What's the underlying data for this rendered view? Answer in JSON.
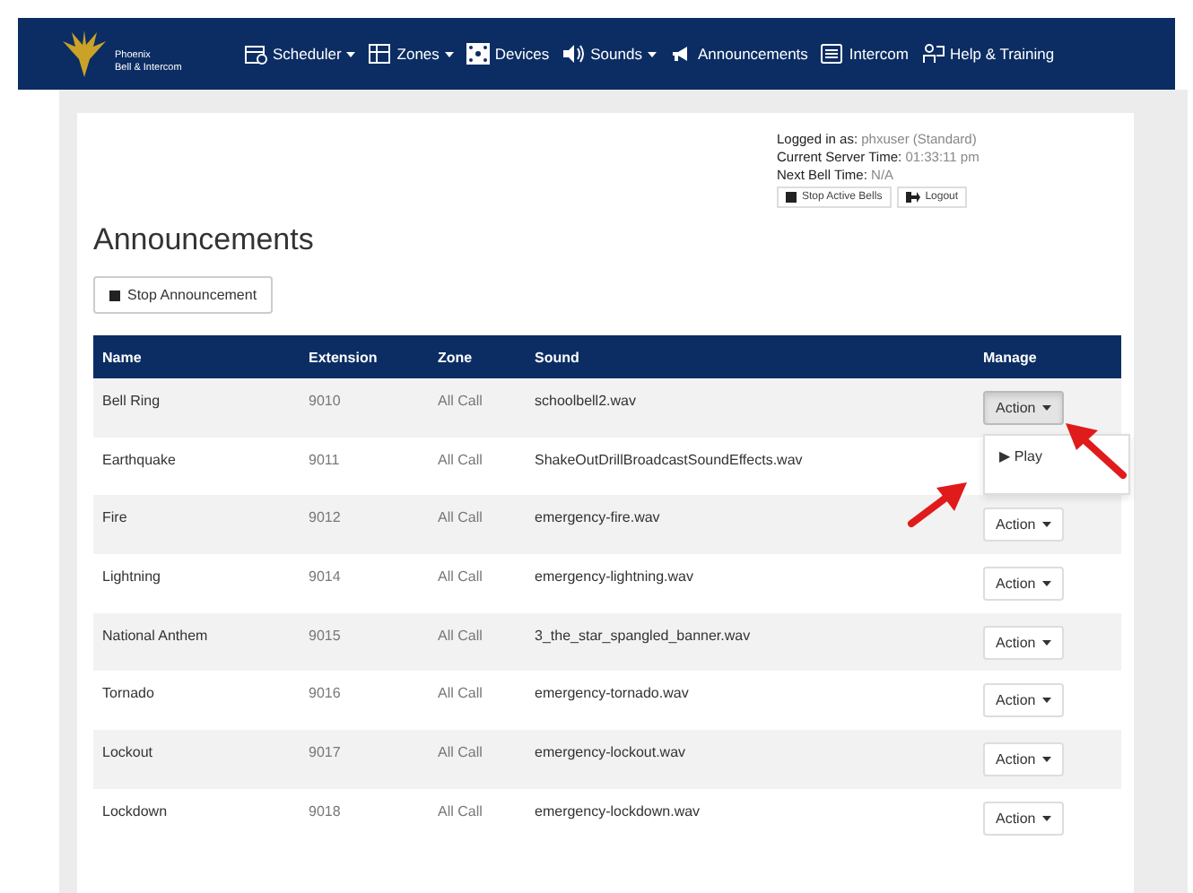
{
  "brand": {
    "name": "Phoenix",
    "subtitle": "Bell & Intercom"
  },
  "nav": [
    {
      "label": "Scheduler",
      "dropdown": true
    },
    {
      "label": "Zones",
      "dropdown": true
    },
    {
      "label": "Devices",
      "dropdown": false
    },
    {
      "label": "Sounds",
      "dropdown": true
    },
    {
      "label": "Announcements",
      "dropdown": false
    },
    {
      "label": "Intercom",
      "dropdown": false
    },
    {
      "label": "Help & Training",
      "dropdown": false
    }
  ],
  "session": [
    {
      "label": "Logged in as:",
      "value": "phxuser (Standard)"
    },
    {
      "label": "Current Server Time:",
      "value": "01:33:11 pm"
    },
    {
      "label": "Next Bell Time:",
      "value": "N/A"
    }
  ],
  "session_buttons": [
    "Stop Active Bells",
    "Logout"
  ],
  "title": "Announcements",
  "stop_button": "Stop Announcement",
  "table": {
    "columns": [
      "Name",
      "Extension",
      "Zone",
      "Sound",
      "Manage"
    ],
    "rows": [
      {
        "name": "Bell Ring",
        "extension": "9010",
        "zone": "All Call",
        "sound": "schoolbell2.wav",
        "action": "Action",
        "menu_open": true,
        "menu": [
          "▶ Play"
        ]
      },
      {
        "name": "Earthquake",
        "extension": "9011",
        "zone": "All Call",
        "sound": "ShakeOutDrillBroadcastSoundEffects.wav"
      },
      {
        "name": "Fire",
        "extension": "9012",
        "zone": "All Call",
        "sound": "emergency-fire.wav",
        "action": "Action",
        "menu_open": false
      },
      {
        "name": "Lightning",
        "extension": "9014",
        "zone": "All Call",
        "sound": "emergency-lightning.wav",
        "action": "Action",
        "menu_open": false
      },
      {
        "name": "National Anthem",
        "extension": "9015",
        "zone": "All Call",
        "sound": "3_the_star_spangled_banner.wav",
        "action": "Action",
        "menu_open": false
      },
      {
        "name": "Tornado",
        "extension": "9016",
        "zone": "All Call",
        "sound": "emergency-tornado.wav",
        "action": "Action",
        "menu_open": false
      },
      {
        "name": "Lockout",
        "extension": "9017",
        "zone": "All Call",
        "sound": "emergency-lockout.wav",
        "action": "Action",
        "menu_open": false
      },
      {
        "name": "Lockdown",
        "extension": "9018",
        "zone": "All Call",
        "sound": "emergency-lockdown.wav",
        "action": "Action",
        "menu_open": false
      }
    ]
  }
}
